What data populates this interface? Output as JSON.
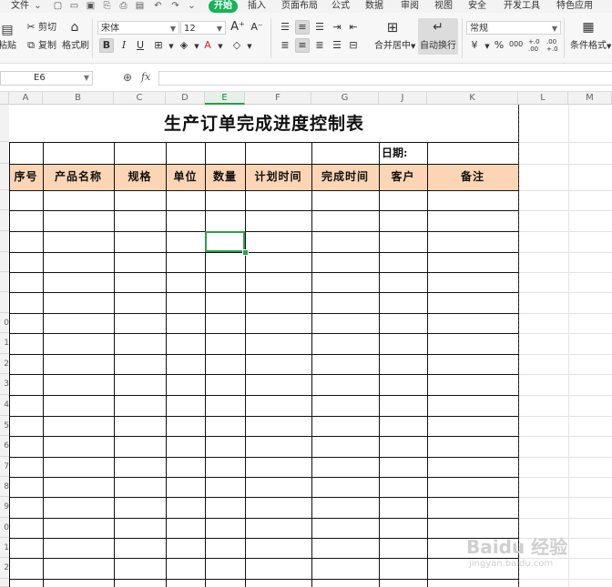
{
  "menu": {
    "file": "文件",
    "tabs": [
      "开始",
      "插入",
      "页面布局",
      "公式",
      "数据",
      "审阅",
      "视图",
      "安全",
      "开发工具",
      "特色应用"
    ]
  },
  "ribbon": {
    "paste": "粘贴",
    "cut": "剪切",
    "copy": "复制",
    "format_painter": "格式刷",
    "font_name": "宋体",
    "font_size": "12",
    "bold": "B",
    "italic": "I",
    "underline": "U",
    "merge_center": "合并居中",
    "wrap_text": "自动换行",
    "number_format": "常规",
    "percent": "%",
    "thousands": "000",
    "inc_decimal": "+.0\n.00",
    "dec_decimal": ".00\n+.0",
    "conditional_format": "条件格式"
  },
  "formula_bar": {
    "cell_ref": "E6",
    "fx": "fx",
    "value": ""
  },
  "columns": [
    "A",
    "B",
    "C",
    "D",
    "E",
    "F",
    "G",
    "J",
    "K",
    "L",
    "M"
  ],
  "selected_column": "E",
  "row_numbers": [
    "0",
    "1",
    "2",
    "3",
    "4",
    "5",
    "6",
    "7",
    "8",
    "9",
    "0",
    "1",
    "2"
  ],
  "sheet": {
    "title": "生产订单完成进度控制表",
    "date_label": "日期:",
    "headers": [
      "序号",
      "产品名称",
      "规格",
      "单位",
      "数量",
      "计划时间",
      "完成时间",
      "客户",
      "备注"
    ]
  },
  "watermark": {
    "text": "Baidu 经验",
    "sub": "jingyan.baidu.com"
  },
  "colors": {
    "accent": "#17b25a",
    "header_fill": "#fcd5b4",
    "selection": "#2e9e4f"
  }
}
